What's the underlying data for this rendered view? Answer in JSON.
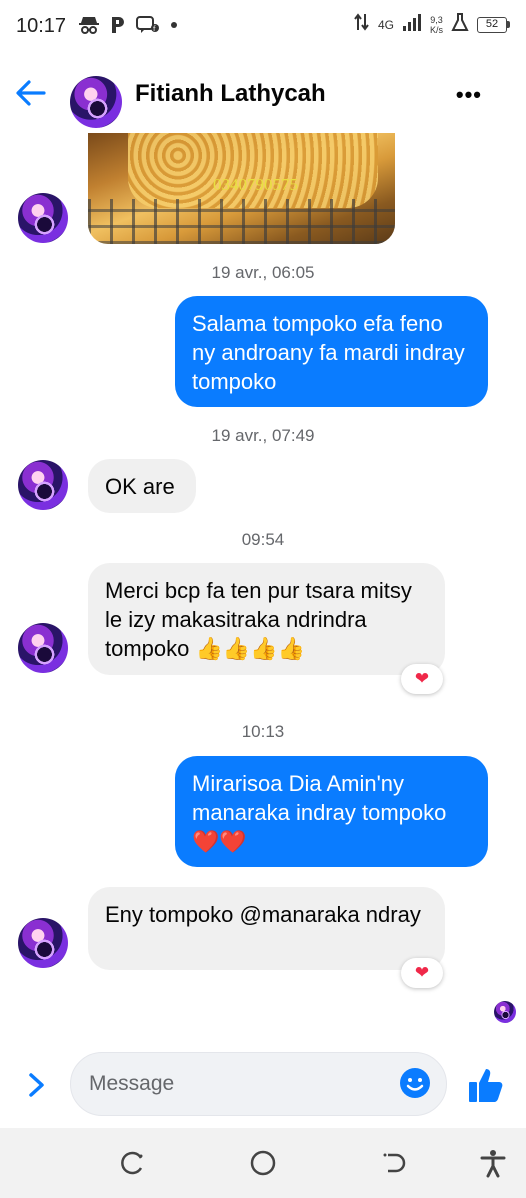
{
  "status_bar": {
    "time": "10:17",
    "network": "4G",
    "speed_value": "9,3",
    "speed_unit": "K/s",
    "battery": "52"
  },
  "header": {
    "contact_name": "Fitianh Lathycah",
    "back_icon": "arrow-left-icon",
    "more_icon": "more-horizontal-icon",
    "more_label": "•••"
  },
  "messages": [
    {
      "type": "photo",
      "direction": "incoming",
      "photo_text": "0340790575"
    },
    {
      "type": "timestamp",
      "text": "19 avr., 06:05"
    },
    {
      "type": "text",
      "direction": "outgoing",
      "text": "Salama tompoko efa feno ny androany fa mardi indray tompoko"
    },
    {
      "type": "timestamp",
      "text": "19 avr., 07:49"
    },
    {
      "type": "text",
      "direction": "incoming",
      "text": "OK are"
    },
    {
      "type": "timestamp",
      "text": "09:54"
    },
    {
      "type": "text",
      "direction": "incoming",
      "text": "Merci bcp fa ten pur tsara mitsy le izy makasitraka ndrindra tompoko 👍👍👍👍",
      "reaction": "❤"
    },
    {
      "type": "timestamp",
      "text": "10:13"
    },
    {
      "type": "text",
      "direction": "outgoing",
      "text": "Mirarisoa Dia Amin'ny manaraka indray tompoko❤️❤️"
    },
    {
      "type": "text",
      "direction": "incoming",
      "text": "Eny tompoko @manaraka ndray",
      "reaction": "❤"
    }
  ],
  "composer": {
    "placeholder": "Message",
    "emoji_icon": "smiley-icon",
    "like_icon": "thumbs-up-icon",
    "expand_icon": "chevron-right-icon"
  },
  "colors": {
    "accent": "#0a7cff",
    "incoming_bubble": "#f0f0f0",
    "timestamp": "#65676b",
    "reaction": "#f02849"
  }
}
